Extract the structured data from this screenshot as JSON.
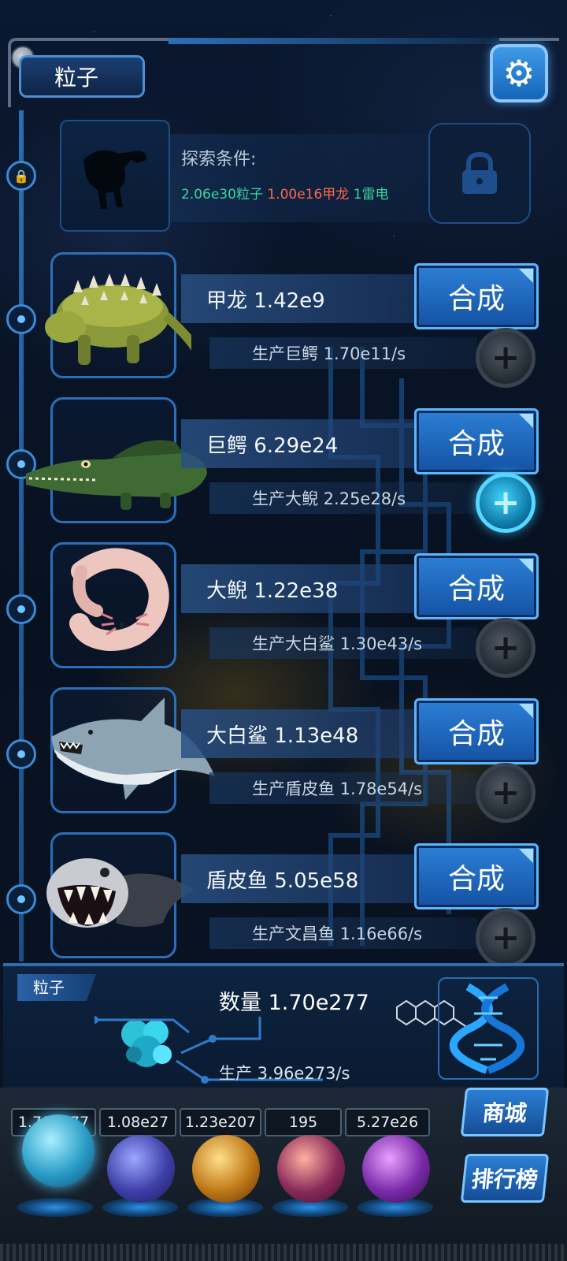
{
  "header": {
    "resource_tab": "粒子",
    "settings_icon": "gear-icon"
  },
  "locked_creature": {
    "condition_title": "探索条件:",
    "req_particles": "2.06e30粒子",
    "req_ankylosaurus": "1.00e16甲龙",
    "req_thunder": "1雷电",
    "colors": {
      "green": "#3ad59e",
      "red": "#ff6a4a"
    }
  },
  "creatures": [
    {
      "name": "甲龙 1.42e9",
      "production": "生产巨鳄 1.70e11/s",
      "combine_label": "合成",
      "plus_active": false
    },
    {
      "name": "巨鳄 6.29e24",
      "production": "生产大鲵 2.25e28/s",
      "combine_label": "合成",
      "plus_active": true
    },
    {
      "name": "大鲵 1.22e38",
      "production": "生产大白鲨 1.30e43/s",
      "combine_label": "合成",
      "plus_active": false
    },
    {
      "name": "大白鲨 1.13e48",
      "production": "生产盾皮鱼 1.78e54/s",
      "combine_label": "合成",
      "plus_active": false
    },
    {
      "name": "盾皮鱼 5.05e58",
      "production": "生产文昌鱼 1.16e66/s",
      "combine_label": "合成",
      "plus_active": false
    }
  ],
  "resource_panel": {
    "tag": "粒子",
    "quantity": "数量 1.70e277",
    "production": "生产 3.96e273/s"
  },
  "bottom": {
    "counters": [
      "1.70e277",
      "1.08e27",
      "1.23e207",
      "195",
      "5.27e26"
    ],
    "shop_label": "商城",
    "rank_label": "排行榜"
  }
}
